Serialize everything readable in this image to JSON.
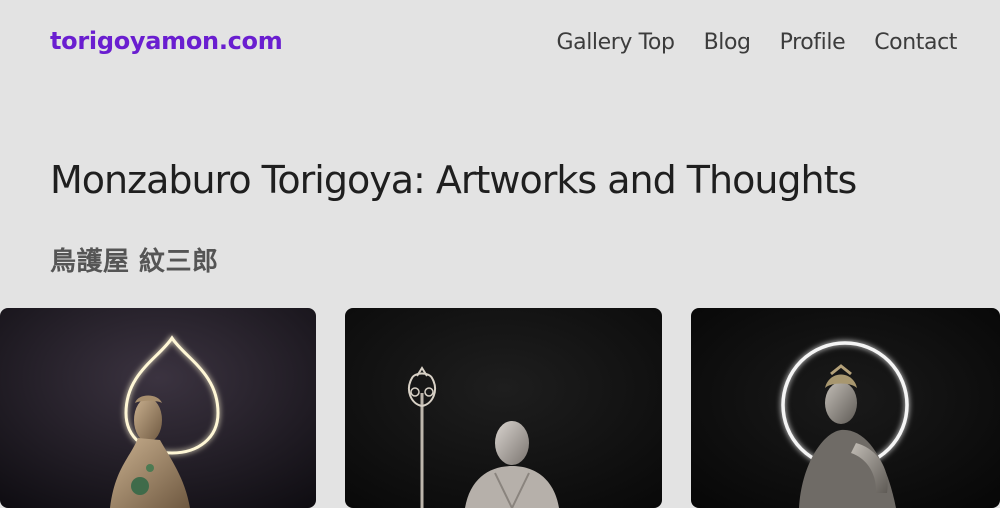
{
  "header": {
    "logo": "torigoyamon.com",
    "nav": [
      {
        "label": "Gallery Top"
      },
      {
        "label": "Blog"
      },
      {
        "label": "Profile"
      },
      {
        "label": "Contact"
      }
    ]
  },
  "main": {
    "title": "Monzaburo Torigoya: Artworks and Thoughts",
    "subtitle": "鳥護屋 紋三郎"
  },
  "gallery": {
    "artworks": [
      {
        "image": "sculpture-with-drop-halo"
      },
      {
        "image": "monk-with-staff"
      },
      {
        "image": "seated-figure-with-ring-halo"
      }
    ]
  },
  "colors": {
    "background": "#e3e3e3",
    "logo": "#6a1ed0",
    "nav_text": "#3c3c3c",
    "title_text": "#1f1f1f"
  }
}
